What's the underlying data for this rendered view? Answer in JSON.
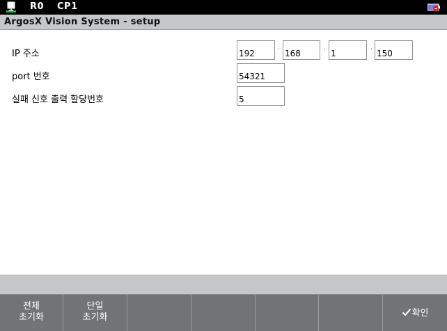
{
  "statusbar": {
    "robot_label": "R0",
    "cp_label": "CP1",
    "network_icon": "network-icon",
    "battery_icon": "battery-icon"
  },
  "window": {
    "title": "ArgosX Vision System - setup"
  },
  "form": {
    "ip_label": "IP 주소",
    "ip_octets": [
      "192",
      "168",
      "1",
      "150"
    ],
    "ip_separator": ".",
    "port_label": "port 번호",
    "port_value": "54321",
    "fail_label": "실패 신호 출력 할당번호",
    "fail_value": "5"
  },
  "footer": {
    "buttons": [
      {
        "line1": "전체",
        "line2": "초기화"
      },
      {
        "line1": "단일",
        "line2": "초기화"
      },
      {
        "label": ""
      },
      {
        "label": ""
      },
      {
        "label": ""
      },
      {
        "label": ""
      },
      {
        "label": "확인",
        "icon": "check-icon"
      }
    ]
  },
  "colors": {
    "title_bar": "#c4c8cb",
    "footer": "#717476",
    "top_bar": "#000000",
    "battery_red": "#d0201a"
  }
}
